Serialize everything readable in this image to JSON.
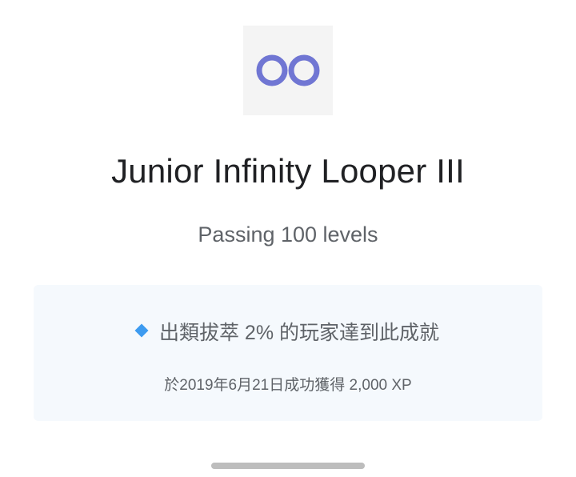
{
  "achievement": {
    "icon": "infinity-icon",
    "title": "Junior Infinity Looper III",
    "description": "Passing 100 levels",
    "rarity_text": "出類拔萃 2% 的玩家達到此成就",
    "earned_text": "於2019年6月21日成功獲得 2,000 XP"
  },
  "colors": {
    "infinity": "#7076d3",
    "diamond": "#3d9bf0",
    "card_bg": "#f5f9fd"
  }
}
